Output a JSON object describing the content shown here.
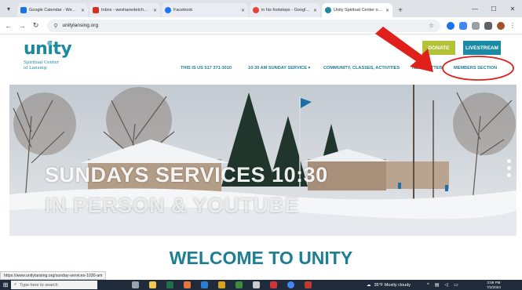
{
  "browser": {
    "tabs": [
      {
        "title": "Google Calendar - Week of Ju",
        "color": "#1a73e8",
        "active": false
      },
      {
        "title": "Inbox - weshanedetchwell@gm",
        "color": "#d93025",
        "active": false
      },
      {
        "title": "Facebook",
        "color": "#1877f2",
        "active": false
      },
      {
        "title": "in his footsteps - Google Sear",
        "color": "#ea4335",
        "active": false
      },
      {
        "title": "Unity Spiritual Center of Lans",
        "color": "#1b8aa0",
        "active": true
      }
    ],
    "address": "unitylansing.org",
    "status_url": "https://www.unitylansing.org/sunday-services-1030-am"
  },
  "site": {
    "logo_word": "unity",
    "logo_sub_1": "Spiritual Center",
    "logo_sub_2": "of Lansing",
    "donate_label": "DONATE",
    "livestream_label": "LIVESTREAM",
    "nav": {
      "phone": "THIS IS US 517 371-3010",
      "service": "10:30 AM SUNDAY SERVICE ▾",
      "community": "COMMUNITY, CLASSES, ACTIVITIES",
      "newsletter": "NEWSLETTER",
      "members": "MEMBERS SECTION"
    },
    "hero_line_1": "SUNDAYS SERVICES 10:30",
    "hero_line_2": "IN PERSON & YOUTUBE",
    "welcome": "WELCOME TO UNITY"
  },
  "taskbar": {
    "search_placeholder": "Type here to search",
    "weather": "35°F  Mostly cloudy",
    "time": "3:58 PM",
    "date": "7/2/2024"
  },
  "colors": {
    "brand_teal": "#1b8aa0",
    "donate_green": "#b4c23a",
    "annotation_red": "#e0201b"
  }
}
